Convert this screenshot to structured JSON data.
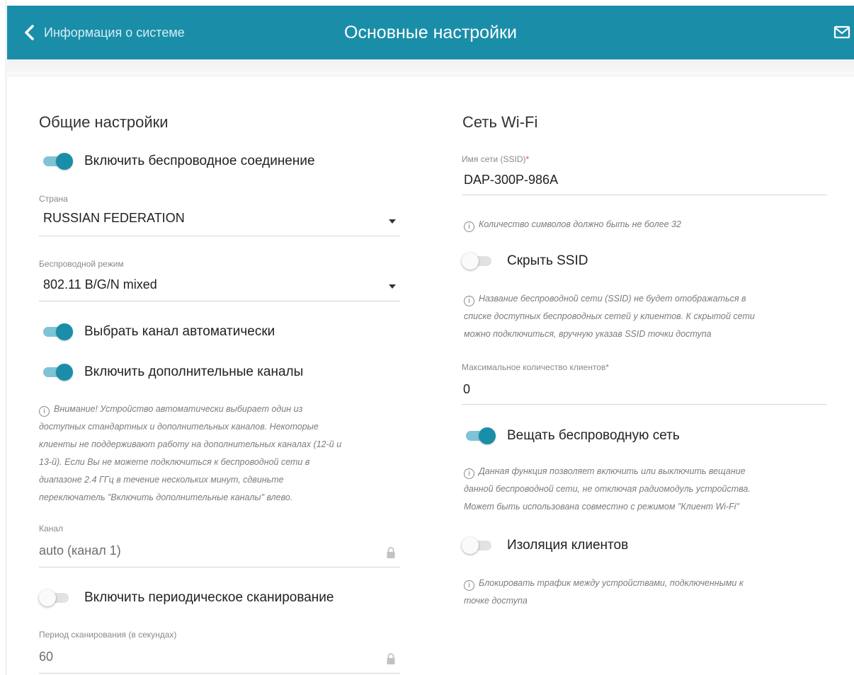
{
  "header": {
    "back_label": "Информация о системе",
    "title": "Основные настройки",
    "back_icon": "chevron-left-icon",
    "mail_icon": "mail-icon"
  },
  "general": {
    "section_title": "Общие настройки",
    "enable_wireless": {
      "label": "Включить беспроводное соединение",
      "on": true
    },
    "country": {
      "label": "Страна",
      "value": "RUSSIAN FEDERATION"
    },
    "wireless_mode": {
      "label": "Беспроводной режим",
      "value": "802.11 B/G/N mixed"
    },
    "auto_channel": {
      "label": "Выбрать канал автоматически",
      "on": true
    },
    "extra_channels": {
      "label": "Включить дополнительные каналы",
      "on": true
    },
    "extra_channels_hint": [
      "Внимание! Устройство автоматически выбирает один из",
      "доступных стандартных и дополнительных каналов. Некоторые",
      "клиенты не поддерживают работу на дополнительных каналах (12-й и",
      "13-й). Если Вы не можете подключиться к беспроводной сети в",
      "диапазоне 2.4 ГГц в течение нескольких минут, сдвиньте",
      "переключатель \"Включить дополнительные каналы\" влево."
    ],
    "channel": {
      "label": "Канал",
      "value": "auto (канал 1)"
    },
    "periodic_scan": {
      "label": "Включить периодическое сканирование",
      "on": false
    },
    "scan_period": {
      "label": "Период сканирования (в секундах)",
      "value": "60"
    }
  },
  "wifi": {
    "section_title": "Сеть Wi-Fi",
    "ssid": {
      "label": "Имя сети (SSID)",
      "required_mark": "*",
      "value": "DAP-300P-986A"
    },
    "ssid_hint": "Количество символов должно быть не более 32",
    "hide_ssid": {
      "label": "Скрыть SSID",
      "on": false
    },
    "hide_ssid_hint": [
      "Название беспроводной сети (SSID) не будет отображаться в",
      "списке доступных беспроводных сетей у клиентов. К скрытой сети",
      "можно подключиться, вручную указав SSID точки доступа"
    ],
    "max_clients": {
      "label": "Максимальное количество клиентов",
      "required_mark": "*",
      "value": "0"
    },
    "broadcast": {
      "label": "Вещать беспроводную сеть",
      "on": true
    },
    "broadcast_hint": [
      "Данная функция позволяет включить или выключить вещание",
      "данной беспроводной сети, не отключая радиомодуль устройства.",
      "Может быть использована совместно с режимом \"Клиент Wi-Fi\""
    ],
    "isolation": {
      "label": "Изоляция клиентов",
      "on": false
    },
    "isolation_hint": [
      "Блокировать трафик между устройствами, подключенными к",
      "точке доступа"
    ]
  },
  "info_glyph": "i",
  "colors": {
    "brand": "#1a8ea9",
    "toggle_on": "#1a8ea9",
    "toggle_track_on": "#7fc3d6"
  }
}
